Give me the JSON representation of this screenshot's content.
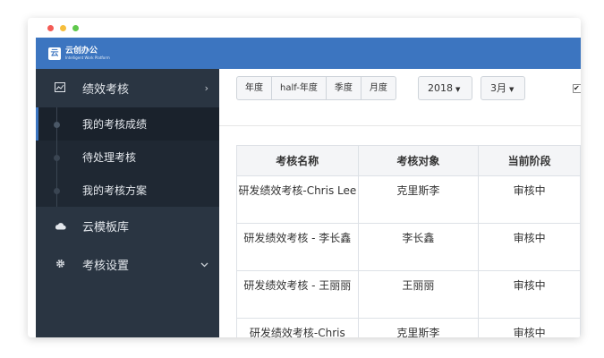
{
  "app": {
    "logo_char": "云",
    "title": "云创办公",
    "subtitle": "Intelligent Work Platform"
  },
  "sidebar": {
    "items": [
      {
        "icon": "chart-icon",
        "label": "绩效考核",
        "arrow": "›",
        "expanded": true
      },
      {
        "icon": "cloud-icon",
        "label": "云模板库"
      },
      {
        "icon": "gear-icon",
        "label": "考核设置",
        "arrow": "⌄"
      }
    ],
    "subitems": [
      {
        "label": "我的考核成绩",
        "active": true
      },
      {
        "label": "待处理考核"
      },
      {
        "label": "我的考核方案"
      }
    ]
  },
  "filters": {
    "periods": [
      "年度",
      "half-年度",
      "季度",
      "月度"
    ],
    "year": "2018",
    "month": "3月",
    "checkbox_checked": true
  },
  "table": {
    "headers": [
      "考核名称",
      "考核对象",
      "当前阶段"
    ],
    "rows": [
      [
        "研发绩效考核-Chris Lee",
        "克里斯李",
        "审核中"
      ],
      [
        "研发绩效考核 - 李长鑫",
        "李长鑫",
        "审核中"
      ],
      [
        "研发绩效考核 - 王丽丽",
        "王丽丽",
        "审核中"
      ],
      [
        "研发绩效考核-Chris",
        "克里斯李",
        "审核中"
      ]
    ]
  },
  "colors": {
    "primary": "#3c75c0",
    "sidebar": "#2a3542",
    "submenu": "#1f2833"
  }
}
